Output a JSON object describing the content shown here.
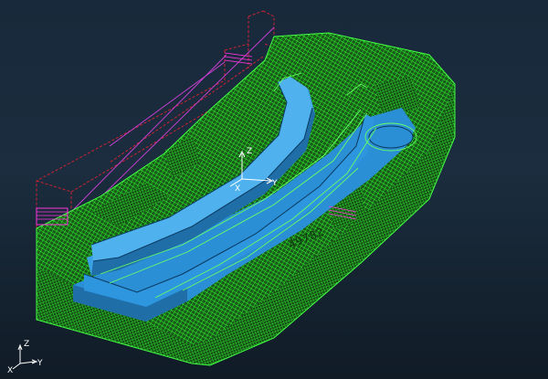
{
  "viewport": {
    "background_top": "#17293a",
    "background_bottom": "#101b26"
  },
  "part": {
    "engraved_text": "49782",
    "colors": {
      "wireframe_green": "#22ff22",
      "toolpath_green": "#55ff55",
      "surface_blue": "#2b8fd6",
      "surface_blue_light": "#4fb2ee",
      "surface_blue_dark": "#1f6ea8",
      "fixture_red": "#cc2233",
      "fixture_magenta": "#ff33dd"
    }
  },
  "workplane_triad": {
    "x": "X",
    "y": "Y",
    "z": "Z"
  },
  "view_triad": {
    "x": "X",
    "y": "Y",
    "z": "Z"
  }
}
